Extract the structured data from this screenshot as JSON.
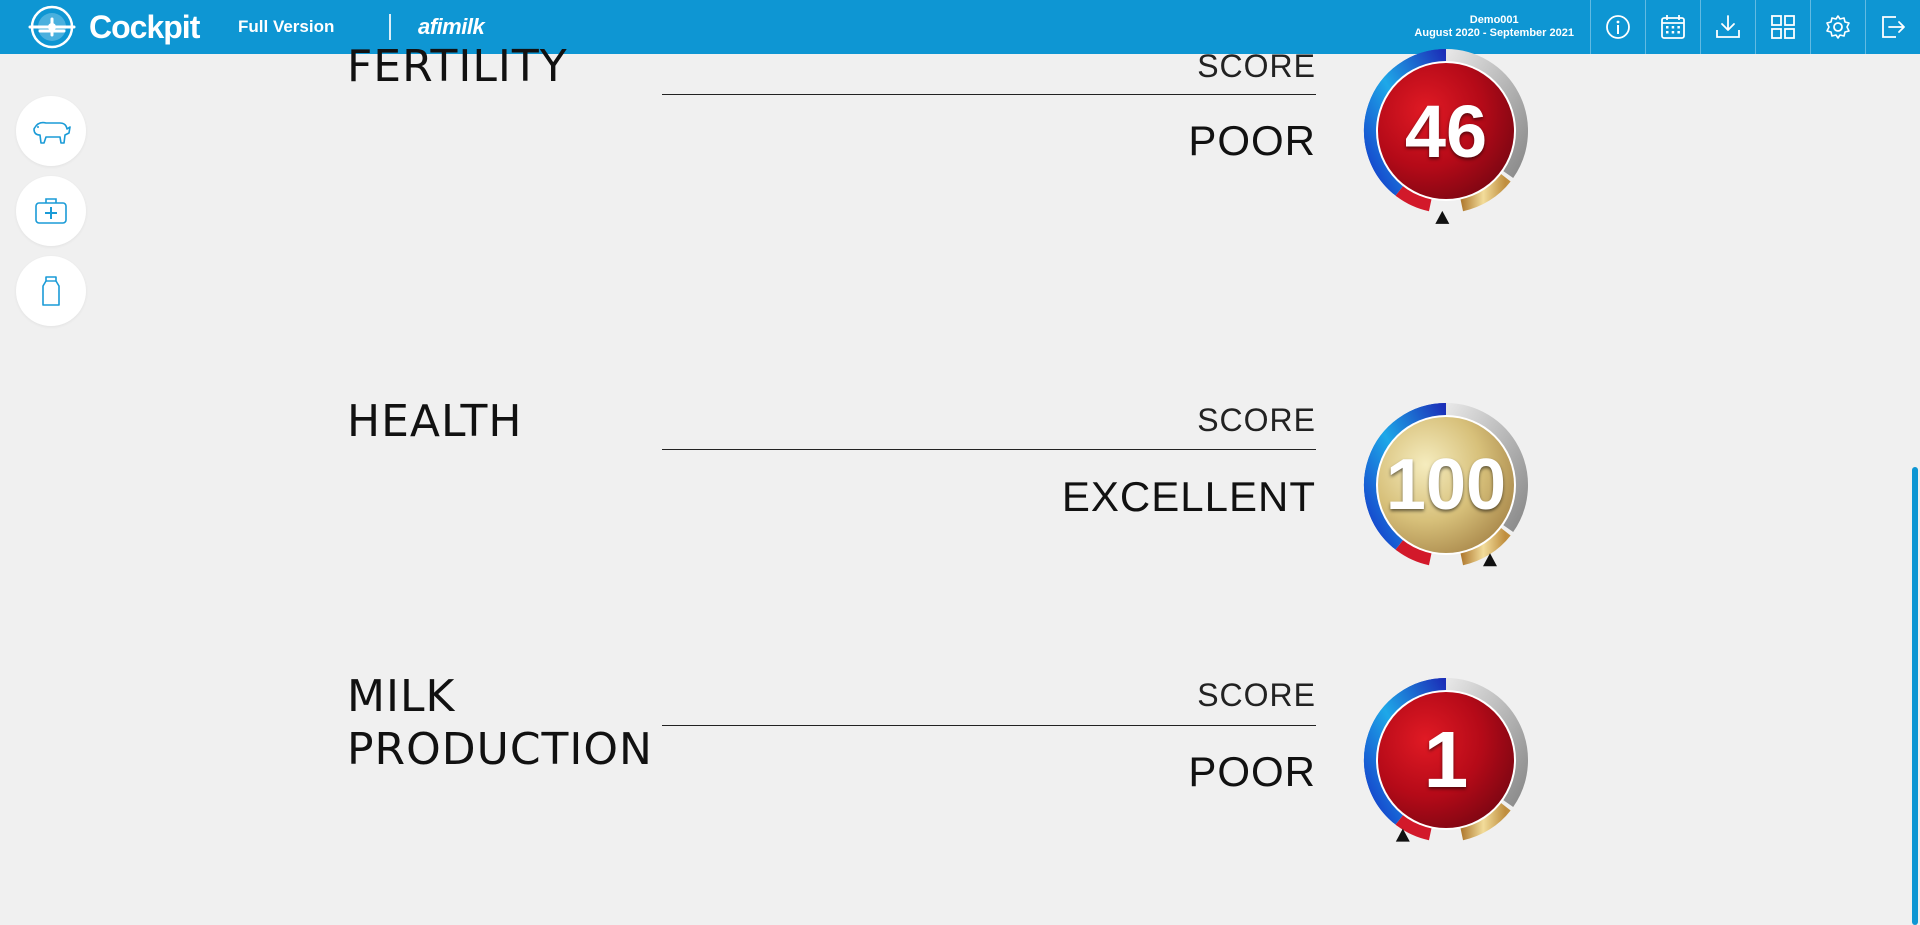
{
  "header": {
    "app_title": "Cockpit",
    "version": "Full Version",
    "brand": "afimilk",
    "farm_name": "Demo001",
    "date_range": "August 2020 - September 2021",
    "icons": [
      "info-icon",
      "calendar-icon",
      "download-icon",
      "dashboard-grid-icon",
      "settings-icon",
      "logout-icon"
    ]
  },
  "side_nav": [
    "cow-icon",
    "medical-kit-icon",
    "milk-bottle-icon"
  ],
  "sections": [
    {
      "title": "FERTILITY",
      "score_label": "SCORE",
      "rating": "POOR",
      "score": "46",
      "score_fraction": 0.46
    },
    {
      "title": "HEALTH",
      "score_label": "SCORE",
      "rating": "EXCELLENT",
      "score": "100",
      "score_fraction": 1.0
    },
    {
      "title_line1": "MILK",
      "title_line2": "PRODUCTION",
      "score_label": "SCORE",
      "rating": "POOR",
      "score": "1",
      "score_fraction": 0.01
    }
  ],
  "colors": {
    "brand_blue": "#0e96d3",
    "poor_red": "#c8101e",
    "excellent_gold": "#c9b06a"
  }
}
